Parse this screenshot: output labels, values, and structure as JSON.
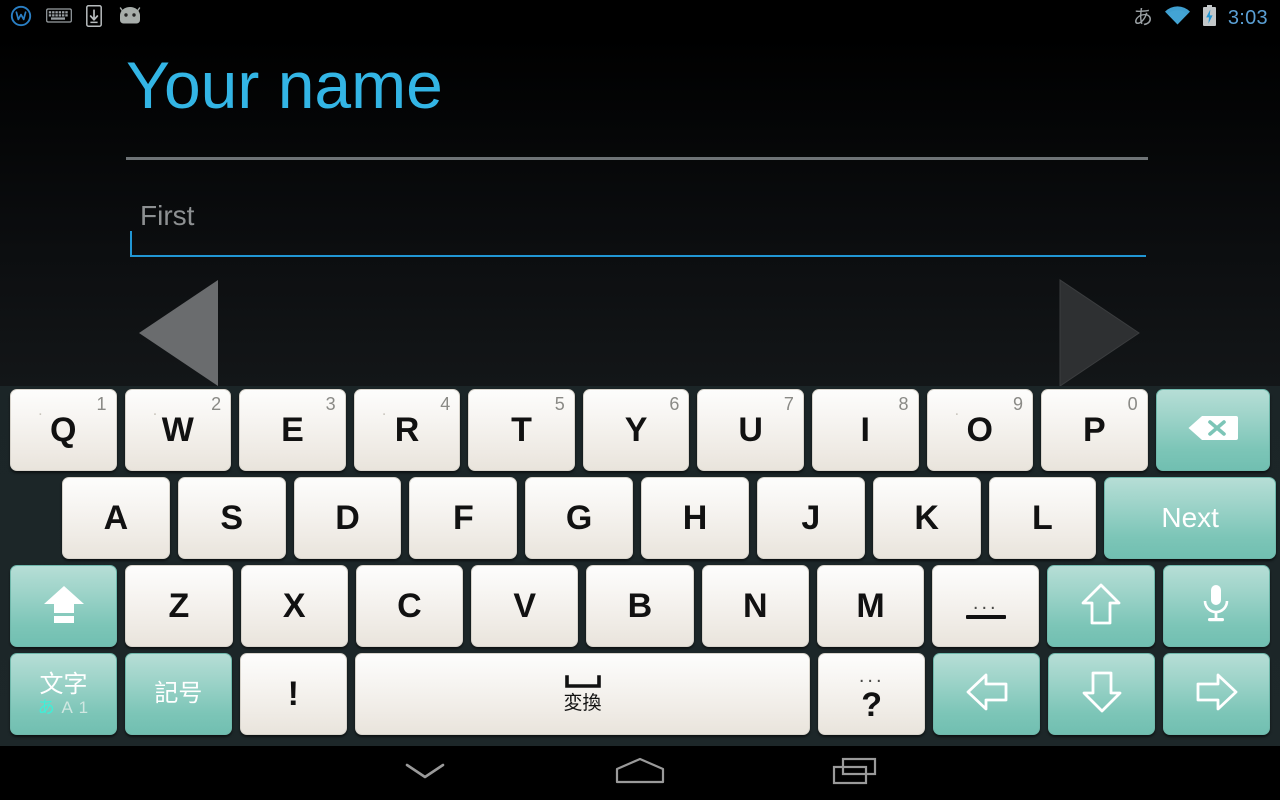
{
  "statusbar": {
    "left_icons": [
      {
        "name": "wire-logo-icon",
        "glyph": "W"
      },
      {
        "name": "keyboard-icon",
        "glyph": "keyboard"
      },
      {
        "name": "download-icon",
        "glyph": "download"
      },
      {
        "name": "android-mascot-icon",
        "glyph": "android"
      }
    ],
    "ime_indicator": "あ",
    "wifi_icon": "wifi-icon",
    "battery_icon": "battery-charging-icon",
    "time": "3:03",
    "time_color": "#5a9fd4"
  },
  "content": {
    "title": "Your name",
    "title_color": "#33b5e5",
    "name_field": {
      "value": "",
      "placeholder": "First",
      "underline_color": "#2196d4"
    },
    "prev_arrow": {
      "name": "previous-arrow",
      "enabled": true,
      "color": "#6a6c6e"
    },
    "next_arrow": {
      "name": "next-arrow",
      "enabled": false,
      "color": "#2c2e30"
    }
  },
  "keyboard": {
    "row1": [
      {
        "main": "Q",
        "sup": "1",
        "dot": true,
        "style": "light",
        "width": "w-std"
      },
      {
        "main": "W",
        "sup": "2",
        "dot": true,
        "style": "light",
        "width": "w-std"
      },
      {
        "main": "E",
        "sup": "3",
        "dot": false,
        "style": "light",
        "width": "w-std"
      },
      {
        "main": "R",
        "sup": "4",
        "dot": true,
        "style": "light",
        "width": "w-std"
      },
      {
        "main": "T",
        "sup": "5",
        "dot": false,
        "style": "light",
        "width": "w-std"
      },
      {
        "main": "Y",
        "sup": "6",
        "dot": false,
        "style": "light",
        "width": "w-std"
      },
      {
        "main": "U",
        "sup": "7",
        "dot": false,
        "style": "light",
        "width": "w-std"
      },
      {
        "main": "I",
        "sup": "8",
        "dot": false,
        "style": "light",
        "width": "w-std"
      },
      {
        "main": "O",
        "sup": "9",
        "dot": true,
        "style": "light",
        "width": "w-std"
      },
      {
        "main": "P",
        "sup": "0",
        "dot": false,
        "style": "light",
        "width": "w-std"
      }
    ],
    "backspace": {
      "name": "backspace-key",
      "icon": "backspace-icon"
    },
    "row2": [
      {
        "main": "A",
        "style": "light",
        "width": "w-std"
      },
      {
        "main": "S",
        "style": "light",
        "width": "w-std"
      },
      {
        "main": "D",
        "style": "light",
        "width": "w-std"
      },
      {
        "main": "F",
        "style": "light",
        "width": "w-std"
      },
      {
        "main": "G",
        "style": "light",
        "width": "w-std"
      },
      {
        "main": "H",
        "style": "light",
        "width": "w-std"
      },
      {
        "main": "J",
        "style": "light",
        "width": "w-std"
      },
      {
        "main": "K",
        "style": "light",
        "width": "w-std"
      },
      {
        "main": "L",
        "style": "light",
        "width": "w-std"
      }
    ],
    "next_key": {
      "name": "next-enter-key",
      "label": "Next"
    },
    "shift_key": {
      "name": "shift-key",
      "icon": "shift-icon"
    },
    "row3": [
      {
        "main": "Z",
        "style": "light",
        "width": "w-std"
      },
      {
        "main": "X",
        "style": "light",
        "width": "w-std"
      },
      {
        "main": "C",
        "style": "light",
        "width": "w-std"
      },
      {
        "main": "V",
        "style": "light",
        "width": "w-std"
      },
      {
        "main": "B",
        "style": "light",
        "width": "w-std"
      },
      {
        "main": "N",
        "style": "light",
        "width": "w-std"
      },
      {
        "main": "M",
        "style": "light",
        "width": "w-std"
      }
    ],
    "dash_key": {
      "name": "dash-key",
      "dots": "...",
      "symbol": "—"
    },
    "up_key": {
      "name": "arrow-up-key",
      "icon": "arrow-up-icon"
    },
    "mic_key": {
      "name": "microphone-key",
      "icon": "microphone-icon"
    },
    "moji_key": {
      "name": "moji-mode-key",
      "label": "文字",
      "sub_kana": "あ",
      "sub_rest": "A 1"
    },
    "kigou_key": {
      "name": "kigou-symbol-key",
      "label": "記号"
    },
    "exclaim_key": {
      "name": "exclamation-key",
      "label": "!"
    },
    "space_key": {
      "name": "space-key",
      "label": "変換",
      "glyph": "space-bar-icon"
    },
    "question_key": {
      "name": "question-key",
      "dots": "...",
      "label": "?"
    },
    "left_key": {
      "name": "arrow-left-key",
      "icon": "arrow-left-icon"
    },
    "down_key": {
      "name": "arrow-down-key",
      "icon": "arrow-down-icon"
    },
    "right_key": {
      "name": "arrow-right-key",
      "icon": "arrow-right-icon"
    },
    "key_light_color": "#f5f2ed",
    "key_teal_color": "#8ccbbf",
    "bg_color": "#1c2628"
  },
  "navbar": {
    "back": {
      "name": "hide-keyboard-button",
      "icon": "chevron-down-icon"
    },
    "home": {
      "name": "home-button",
      "icon": "home-icon"
    },
    "recents": {
      "name": "recents-button",
      "icon": "recents-icon"
    }
  }
}
